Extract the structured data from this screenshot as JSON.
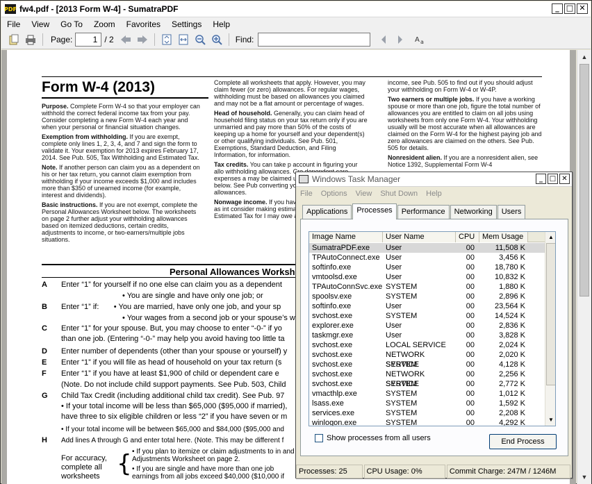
{
  "app": {
    "title": "fw4.pdf - [2013 Form W-4] - SumatraPDF",
    "icon_label": "PDF",
    "window_controls": [
      "_",
      "□",
      "✕"
    ]
  },
  "menubar": [
    "File",
    "View",
    "Go To",
    "Zoom",
    "Favorites",
    "Settings",
    "Help"
  ],
  "toolbar": {
    "page_label": "Page:",
    "page_value": "1",
    "page_total": "/ 2",
    "find_label": "Find:",
    "find_value": ""
  },
  "document": {
    "form_title": "Form W-4 (2013)",
    "col1": [
      {
        "head": "Purpose.",
        "text": " Complete Form W-4 so that your employer can withhold the correct federal income tax from your pay. Consider completing a new Form W-4 each year and when your personal or financial situation changes."
      },
      {
        "head": "Exemption from withholding.",
        "text": " If you are exempt, complete only lines 1, 2, 3, 4, and 7 and sign the form to validate it. Your exemption for 2013 expires February 17, 2014. See Pub. 505, Tax Withholding and Estimated Tax."
      },
      {
        "head": "Note.",
        "text": " If another person can claim you as a dependent on his or her tax return, you cannot claim exemption from withholding if your income exceeds $1,000 and includes more than $350 of unearned income (for example, interest and dividends)."
      },
      {
        "head": "Basic instructions.",
        "text": " If you are not exempt, complete the Personal Allowances Worksheet below. The worksheets on page 2 further adjust your withholding allowances based on itemized deductions, certain credits, adjustments to income, or two-earners/multiple jobs situations."
      }
    ],
    "col2": [
      {
        "head": "",
        "text": "Complete all worksheets that apply. However, you may claim fewer (or zero) allowances. For regular wages, withholding must be based on allowances you claimed and may not be a flat amount or percentage of wages."
      },
      {
        "head": "Head of household.",
        "text": " Generally, you can claim head of household filing status on your tax return only if you are unmarried and pay more than 50% of the costs of keeping up a home for yourself and your dependent(s) or other qualifying individuals. See Pub. 501, Exemptions, Standard Deduction, and Filing Information, for information."
      },
      {
        "head": "Tax credits.",
        "text": " You can take p account in figuring your allo withholding allowances. Cre dependent care expenses a may be claimed using the P Worksheet below. See Pub converting your other credit allowances."
      },
      {
        "head": "Nonwage income.",
        "text": " If you hav nonwage income, such as int consider making estimated ta 1040-ES, Estimated Tax for I may owe additional tax. If you"
      }
    ],
    "col3": [
      {
        "head": "",
        "text": "income, see Pub. 505 to find out if you should adjust your withholding on Form W-4 or W-4P."
      },
      {
        "head": "Two earners or multiple jobs.",
        "text": " If you have a working spouse or more than one job, figure the total number of allowances you are entitled to claim on all jobs using worksheets from only one Form W-4. Your withholding usually will be most accurate when all allowances are claimed on the Form W-4 for the highest paying job and zero allowances are claimed on the others. See Pub. 505 for details."
      },
      {
        "head": "Nonresident alien.",
        "text": " If you are a nonresident alien, see Notice 1392, Supplemental Form W-4"
      }
    ],
    "worksheet_title": "Personal Allowances Worksh",
    "lines": [
      {
        "letter": "A",
        "text": "Enter “1” for yourself if no one else can claim you as a dependent"
      },
      {
        "letter": "",
        "text": "• You are single and have only one job; or"
      },
      {
        "letter": "B",
        "text": "Enter “1” if:       • You are married, have only one job, and your sp"
      },
      {
        "letter": "",
        "text": "• Your wages from a second job or your spouse’s w"
      },
      {
        "letter": "C",
        "text": "Enter “1” for your spouse. But, you may choose to enter “-0-” if yo"
      },
      {
        "letter": "",
        "text": "than one job. (Entering “-0-” may help you avoid having too little ta"
      },
      {
        "letter": "D",
        "text": "Enter number of dependents (other than your spouse or yourself) y"
      },
      {
        "letter": "E",
        "text": "Enter “1” if you will file as head of household on your tax return (s"
      },
      {
        "letter": "F",
        "text": "Enter “1” if you have at least $1,900 of child or dependent care e"
      },
      {
        "letter": "",
        "text": "(Note. Do not include child support payments. See Pub. 503, Child"
      },
      {
        "letter": "G",
        "text": "Child Tax Credit (including additional child tax credit). See Pub. 97"
      },
      {
        "letter": "",
        "text": "• If your total income will be less than $65,000 ($95,000 if married),"
      },
      {
        "letter": "",
        "text": "have three to six eligible children or less “2” if you have seven or m"
      },
      {
        "letter": "",
        "text": "• If your total income will be between $65,000 and $84,000 ($95,000 and"
      },
      {
        "letter": "H",
        "text": "Add lines A through G and enter total here. (Note. This may be different f"
      }
    ],
    "accuracy_label": "For accuracy, complete all worksheets",
    "accuracy_items": [
      "• If you plan to itemize or claim adjustments to in and Adjustments Worksheet on page 2.",
      "• If you are single and have more than one job earnings from all jobs exceed $40,000 ($10,000 if"
    ]
  },
  "taskmanager": {
    "title": "Windows Task Manager",
    "menu": [
      "File",
      "Options",
      "View",
      "Shut Down",
      "Help"
    ],
    "tabs": [
      "Applications",
      "Processes",
      "Performance",
      "Networking",
      "Users"
    ],
    "active_tab": "Processes",
    "columns": [
      "Image Name",
      "User Name",
      "CPU",
      "Mem Usage"
    ],
    "rows": [
      {
        "image": "SumatraPDF.exe",
        "user": "User",
        "cpu": "00",
        "mem": "11,508 K"
      },
      {
        "image": "TPAutoConnect.exe",
        "user": "User",
        "cpu": "00",
        "mem": "3,456 K"
      },
      {
        "image": "softinfo.exe",
        "user": "User",
        "cpu": "00",
        "mem": "18,780 K"
      },
      {
        "image": "vmtoolsd.exe",
        "user": "User",
        "cpu": "00",
        "mem": "10,832 K"
      },
      {
        "image": "TPAutoConnSvc.exe",
        "user": "SYSTEM",
        "cpu": "00",
        "mem": "1,880 K"
      },
      {
        "image": "spoolsv.exe",
        "user": "SYSTEM",
        "cpu": "00",
        "mem": "2,896 K"
      },
      {
        "image": "softinfo.exe",
        "user": "User",
        "cpu": "00",
        "mem": "23,564 K"
      },
      {
        "image": "svchost.exe",
        "user": "SYSTEM",
        "cpu": "00",
        "mem": "14,524 K"
      },
      {
        "image": "explorer.exe",
        "user": "User",
        "cpu": "00",
        "mem": "2,836 K"
      },
      {
        "image": "taskmgr.exe",
        "user": "User",
        "cpu": "00",
        "mem": "3,828 K"
      },
      {
        "image": "svchost.exe",
        "user": "LOCAL SERVICE",
        "cpu": "00",
        "mem": "2,024 K"
      },
      {
        "image": "svchost.exe",
        "user": "NETWORK SERVICE",
        "cpu": "00",
        "mem": "2,020 K"
      },
      {
        "image": "svchost.exe",
        "user": "SYSTEM",
        "cpu": "00",
        "mem": "4,128 K"
      },
      {
        "image": "svchost.exe",
        "user": "NETWORK SERVICE",
        "cpu": "00",
        "mem": "2,256 K"
      },
      {
        "image": "svchost.exe",
        "user": "SYSTEM",
        "cpu": "00",
        "mem": "2,772 K"
      },
      {
        "image": "vmacthlp.exe",
        "user": "SYSTEM",
        "cpu": "00",
        "mem": "1,012 K"
      },
      {
        "image": "lsass.exe",
        "user": "SYSTEM",
        "cpu": "00",
        "mem": "1,592 K"
      },
      {
        "image": "services.exe",
        "user": "SYSTEM",
        "cpu": "00",
        "mem": "2,208 K"
      },
      {
        "image": "winlogon.exe",
        "user": "SYSTEM",
        "cpu": "00",
        "mem": "4,292 K"
      }
    ],
    "show_all_label": "Show processes from all users",
    "end_process_label": "End Process",
    "status": {
      "processes": "Processes: 25",
      "cpu": "CPU Usage: 0%",
      "commit": "Commit Charge: 247M / 1246M"
    }
  },
  "colors": {
    "sumatra_icon_bg": "#1a1a1a",
    "sumatra_icon_fg": "#ffd400",
    "doc_bg": "#abaaa5",
    "selection": "#d8d8d8"
  }
}
